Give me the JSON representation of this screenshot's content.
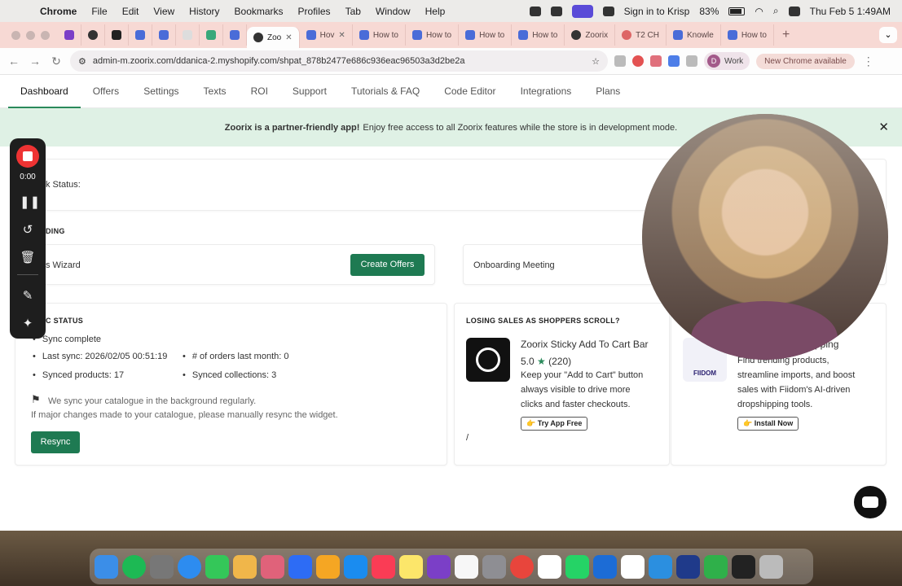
{
  "menubar": {
    "app_name": "Chrome",
    "menus": [
      "File",
      "Edit",
      "View",
      "History",
      "Bookmarks",
      "Profiles",
      "Tab",
      "Window",
      "Help"
    ],
    "krisp": "Sign in to Krisp",
    "battery": "83%",
    "datetime": "Thu Feb 5  1:49AM"
  },
  "tabs": [
    {
      "label": "",
      "icon": "purple"
    },
    {
      "label": "",
      "icon": "z"
    },
    {
      "label": "",
      "icon": "dark"
    },
    {
      "label": "",
      "icon": "blue"
    },
    {
      "label": "",
      "icon": "blue"
    },
    {
      "label": "",
      "icon": "grey"
    },
    {
      "label": "",
      "icon": "green"
    },
    {
      "label": "",
      "icon": "blue"
    },
    {
      "label": "Zoo",
      "icon": "z",
      "active": true
    },
    {
      "label": "Hov",
      "icon": "blue"
    },
    {
      "label": "How to",
      "icon": "blue"
    },
    {
      "label": "How to",
      "icon": "blue"
    },
    {
      "label": "How to",
      "icon": "blue"
    },
    {
      "label": "How to",
      "icon": "blue"
    },
    {
      "label": "Zoorix",
      "icon": "z"
    },
    {
      "label": "T2 CH",
      "icon": "red"
    },
    {
      "label": "Knowle",
      "icon": "blue"
    },
    {
      "label": "How to",
      "icon": "blue"
    }
  ],
  "address": {
    "url": "admin-m.zoorix.com/ddanica-2.myshopify.com/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"
  },
  "profile": {
    "initial": "D",
    "label": "Work"
  },
  "update_label": "New Chrome available",
  "nav": [
    "Dashboard",
    "Offers",
    "Settings",
    "Texts",
    "ROI",
    "Support",
    "Tutorials & FAQ",
    "Code Editor",
    "Integrations",
    "Plans"
  ],
  "banner": {
    "bold": "Zoorix is a partner-friendly app!",
    "text": "Enjoy free access to all Zoorix features while the store is in development mode."
  },
  "status": {
    "label": "k Status:"
  },
  "onboarding": {
    "heading": "DING",
    "wizard_label": "s Wizard",
    "create_offers": "Create Offers",
    "meeting_label": "Onboarding Meeting"
  },
  "sync": {
    "heading": "C STATUS",
    "complete": "Sync complete",
    "last_sync": "Last sync: 2026/02/05 00:51:19",
    "orders": "# of orders last month: 0",
    "products": "Synced products: 17",
    "collections": "Synced collections: 3",
    "note1": "We sync your catalogue in the background regularly.",
    "note2": "If major changes made to your catalogue, please manually resync the widget.",
    "resync": "Resync"
  },
  "promo": {
    "heading": "LOSING SALES AS SHOPPERS SCROLL?",
    "app1": {
      "title": "Zoorix Sticky Add To Cart Bar",
      "rating": "5.0",
      "reviews": "(220)",
      "desc": [
        "Keep your \"Add to Cart\" button",
        "always visible to drive more",
        "clicks and faster checkouts."
      ],
      "cta": "👉 Try App Free"
    },
    "slash": "/",
    "app2": {
      "title": "pping",
      "logo_text": "FIIDOM",
      "desc": [
        "Find trending products,",
        "streamline imports, and boost",
        "sales with Fiidom's AI-driven",
        "dropshipping tools."
      ],
      "cta": "👉 Install Now"
    }
  },
  "recorder": {
    "time": "0:00"
  },
  "colors": {
    "accent": "#1e7a52",
    "banner_bg": "#dff1e5",
    "tabstrip": "#f7d9d4"
  }
}
